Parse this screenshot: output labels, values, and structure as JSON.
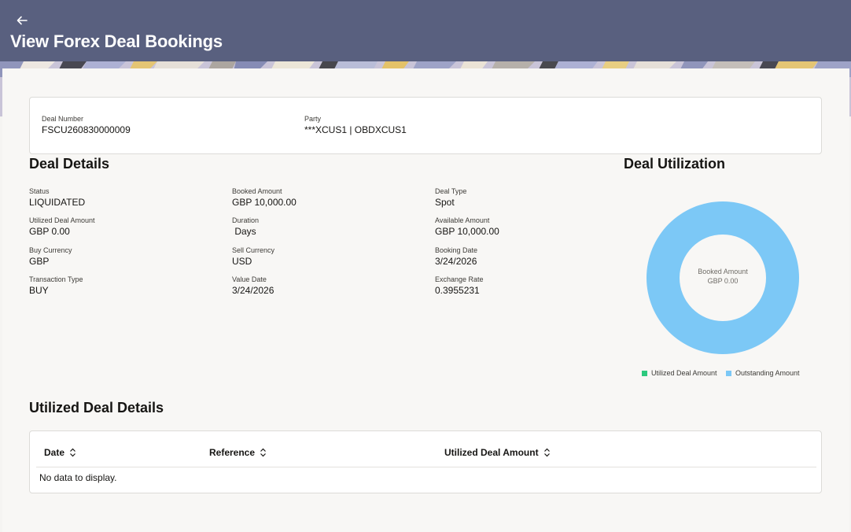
{
  "header": {
    "title": "View Forex Deal Bookings"
  },
  "summary": {
    "deal_number_label": "Deal Number",
    "deal_number": "FSCU260830000009",
    "party_label": "Party",
    "party": "***XCUS1 | OBDXCUS1"
  },
  "deal_details": {
    "title": "Deal Details",
    "fields": [
      {
        "label": "Status",
        "value": "LIQUIDATED"
      },
      {
        "label": "Booked Amount",
        "value": "GBP 10,000.00"
      },
      {
        "label": "Deal Type",
        "value": "Spot"
      },
      {
        "label": "Utilized Deal Amount",
        "value": "GBP 0.00"
      },
      {
        "label": "Duration",
        "value": " Days"
      },
      {
        "label": "Available Amount",
        "value": "GBP 10,000.00"
      },
      {
        "label": "Buy Currency",
        "value": "GBP"
      },
      {
        "label": "Sell Currency",
        "value": "USD"
      },
      {
        "label": "Booking Date",
        "value": "3/24/2026"
      },
      {
        "label": "Transaction Type",
        "value": "BUY"
      },
      {
        "label": "Value Date",
        "value": "3/24/2026"
      },
      {
        "label": "Exchange Rate",
        "value": "0.3955231"
      }
    ]
  },
  "deal_utilization": {
    "title": "Deal Utilization",
    "center_label": "Booked Amount",
    "center_value": "GBP 0.00",
    "legend": [
      {
        "label": "Utilized Deal Amount",
        "color": "#2dc97e"
      },
      {
        "label": "Outstanding Amount",
        "color": "#7cc8f6"
      }
    ]
  },
  "chart_data": {
    "type": "pie",
    "categories": [
      "Utilized Deal Amount",
      "Outstanding Amount"
    ],
    "values": [
      0,
      10000
    ],
    "colors": [
      "#2dc97e",
      "#7cc8f6"
    ],
    "title": "Deal Utilization",
    "legend": "bottom"
  },
  "utilized": {
    "title": "Utilized Deal Details",
    "columns": [
      "Date",
      "Reference",
      "Utilized Deal Amount"
    ],
    "empty_text": "No data to display."
  }
}
